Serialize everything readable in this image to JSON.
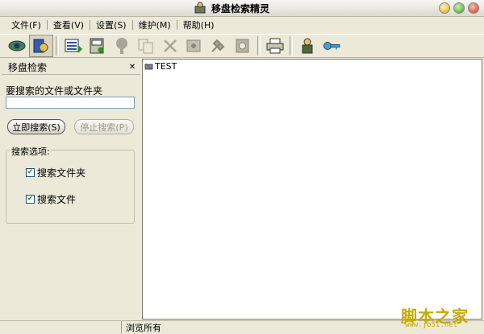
{
  "window": {
    "title": "移盘检索精灵"
  },
  "menu": {
    "items": [
      "文件(F)",
      "查看(V)",
      "设置(S)",
      "维护(M)",
      "帮助(H)"
    ]
  },
  "toolbar": {
    "buttons": [
      {
        "icon": "eye-icon",
        "active": false
      },
      {
        "icon": "search-drive-icon",
        "active": true
      },
      {
        "icon": "list-download-icon",
        "active": false
      },
      {
        "icon": "cabinet-icon",
        "active": false
      },
      {
        "icon": "tree-icon",
        "active": false
      },
      {
        "icon": "copy-icon",
        "active": false
      },
      {
        "icon": "delete-icon",
        "active": false
      },
      {
        "icon": "drive-info-icon",
        "active": false
      },
      {
        "icon": "tools-icon",
        "active": false
      },
      {
        "icon": "disk-icon",
        "active": false
      },
      {
        "icon": "printer-icon",
        "active": false
      },
      {
        "icon": "user-icon",
        "active": false
      },
      {
        "icon": "key-icon",
        "active": false
      }
    ]
  },
  "left_panel": {
    "title": "移盘检索",
    "search_label": "要搜索的文件或文件夹",
    "search_value": "",
    "start_button": "立即搜索(S)",
    "stop_button": "停止搜索(P)",
    "options_legend": "搜索选项:",
    "option_folder": "搜索文件夹",
    "option_file": "搜索文件",
    "option_folder_checked": true,
    "option_file_checked": true
  },
  "tree": {
    "root_label": "TEST"
  },
  "status": {
    "text": "浏览所有"
  },
  "watermark": {
    "main": "脚本之家",
    "sub": "www.jb51.net"
  },
  "colors": {
    "chrome": "#ece9d8",
    "input_border": "#7f9db9",
    "watermark": "#c8a900"
  }
}
